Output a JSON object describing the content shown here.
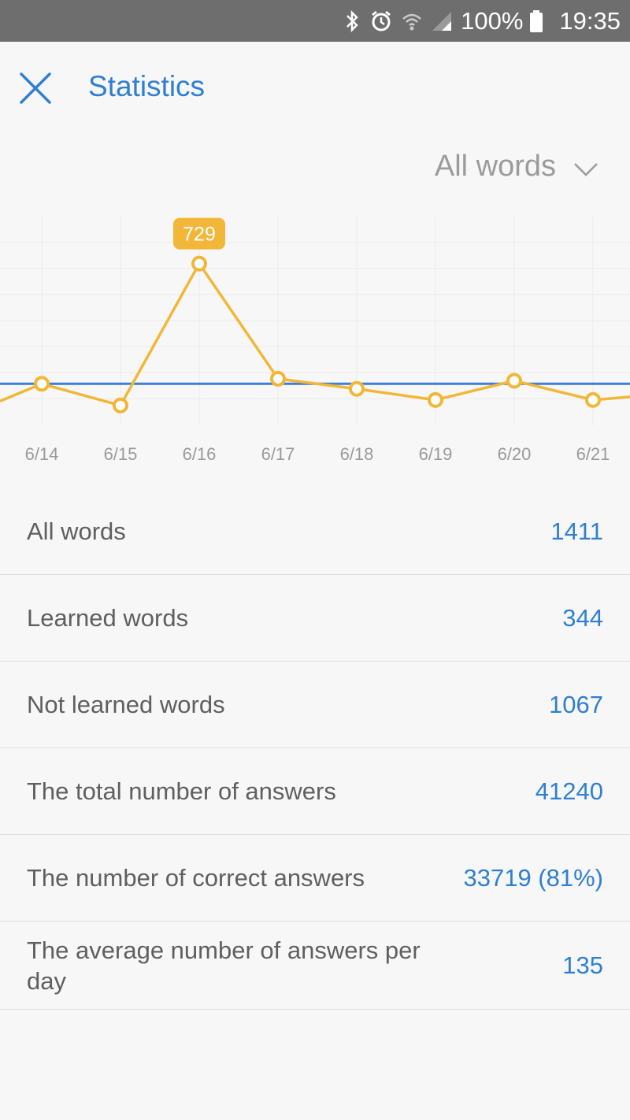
{
  "status_bar": {
    "battery": "100%",
    "time": "19:35"
  },
  "header": {
    "title": "Statistics"
  },
  "filter": {
    "selected": "All words"
  },
  "chart_data": {
    "type": "line",
    "categories": [
      "6/14",
      "6/15",
      "6/16",
      "6/17",
      "6/18",
      "6/19",
      "6/20",
      "6/21"
    ],
    "series": [
      {
        "values": [
          135,
          28,
          729,
          160,
          110,
          55,
          150,
          55
        ]
      }
    ],
    "average": 135,
    "highlight": {
      "category": "6/16",
      "label": "729"
    },
    "ylim": [
      0,
      900
    ],
    "grid": true,
    "colors": {
      "series": "#f2b738",
      "average": "#3b7fd6",
      "grid": "#ebebeb"
    }
  },
  "stats": [
    {
      "label": "All words",
      "value": "1411"
    },
    {
      "label": "Learned words",
      "value": "344"
    },
    {
      "label": "Not learned words",
      "value": "1067"
    },
    {
      "label": "The total number of answers",
      "value": "41240"
    },
    {
      "label": "The number of correct answers",
      "value": "33719 (81%)"
    },
    {
      "label": "The average number of answers per day",
      "value": "135"
    }
  ],
  "colors": {
    "accent": "#2f7fd3",
    "status_bar": "#6e6e6e",
    "background": "#f7f7f7"
  }
}
